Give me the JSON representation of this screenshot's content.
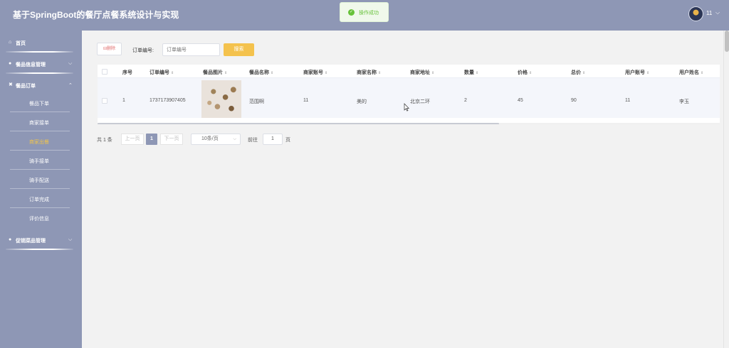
{
  "header": {
    "title": "基于SpringBoot的餐厅点餐系统设计与实现",
    "user_name": "11",
    "user_caret": "⌵",
    "toast": {
      "icon": "✓",
      "text": "操作成功",
      "color": "#67c23a"
    }
  },
  "sidebar": {
    "menus": [
      {
        "icon": "⌂",
        "label": "首页",
        "caret": ""
      },
      {
        "icon": "●",
        "label": "餐品信息管理",
        "caret": "⌵"
      },
      {
        "icon": "✖",
        "label": "餐品订单",
        "caret": "⌃"
      },
      {
        "icon": "●",
        "label": "促销菜品管理",
        "caret": "⌵"
      }
    ],
    "sub_items": [
      {
        "label": "餐品下单",
        "active": false
      },
      {
        "label": "商家接单",
        "active": false
      },
      {
        "label": "商家出餐",
        "active": true
      },
      {
        "label": "骑手接单",
        "active": false
      },
      {
        "label": "骑手配送",
        "active": false
      },
      {
        "label": "订单完成",
        "active": false
      },
      {
        "label": "评价信息",
        "active": false
      }
    ]
  },
  "toolbar": {
    "delete_label": "⊟删除",
    "filter_label": "订单编号:",
    "filter_placeholder": "订单编号",
    "search_label": "搜索"
  },
  "table": {
    "sort_icon": "⇕",
    "columns": [
      "序号",
      "订单编号",
      "餐品图片",
      "餐品名称",
      "商家账号",
      "商家名称",
      "商家地址",
      "数量",
      "价格",
      "总价",
      "用户账号",
      "用户姓名"
    ],
    "rows": [
      {
        "index": "1",
        "order_no": "1737173907405",
        "image": "food-photo",
        "dish": "范围啊",
        "merchant_account": "11",
        "merchant_name": "美的",
        "merchant_address": "北京二环",
        "quantity": "2",
        "price": "45",
        "total": "90",
        "user_account": "11",
        "user_name": "李玉"
      }
    ]
  },
  "pagination": {
    "total": "共 1 条",
    "prev": "上一页",
    "current": "1",
    "next": "下一页",
    "page_size": "10条/页",
    "goto_label": "前往",
    "goto_value": "1",
    "page_label": "页"
  },
  "colors": {
    "brand": "#8e97b5",
    "accent": "#f4c24d",
    "active_menu": "#f0c44c"
  }
}
